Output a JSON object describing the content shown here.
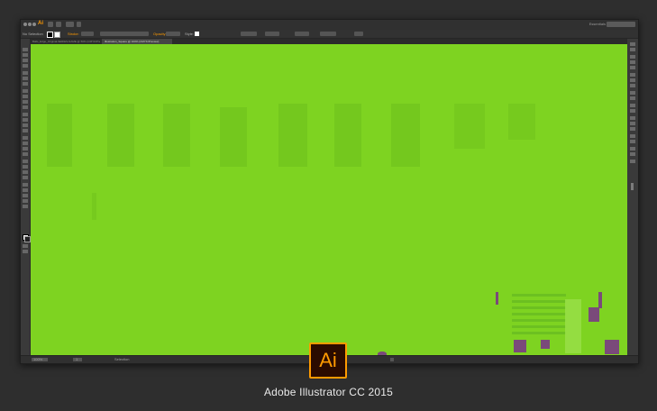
{
  "window": {
    "app_short": "Ai",
    "workspace_label": "Essentials"
  },
  "control_bar": {
    "selection_label": "No Selection",
    "stroke_label": "Stroke:",
    "opacity_label": "Opacity:",
    "style_label": "Style:"
  },
  "tabs": [
    {
      "label": "Balls_Edge_Original-SERIES-NAME @ 50% (CMYK/Preview)"
    },
    {
      "label": "Illustration_Square @ 100% (CMYK/Preview)"
    }
  ],
  "statusbar": {
    "zoom": "100%",
    "page": "1",
    "tool": "Selection"
  },
  "colors": {
    "artboard": "#7ed321",
    "accent": "#ff9a00",
    "purple": "#7a4a7a"
  },
  "logo": {
    "text": "Ai"
  },
  "caption": "Adobe Illustrator CC 2015"
}
